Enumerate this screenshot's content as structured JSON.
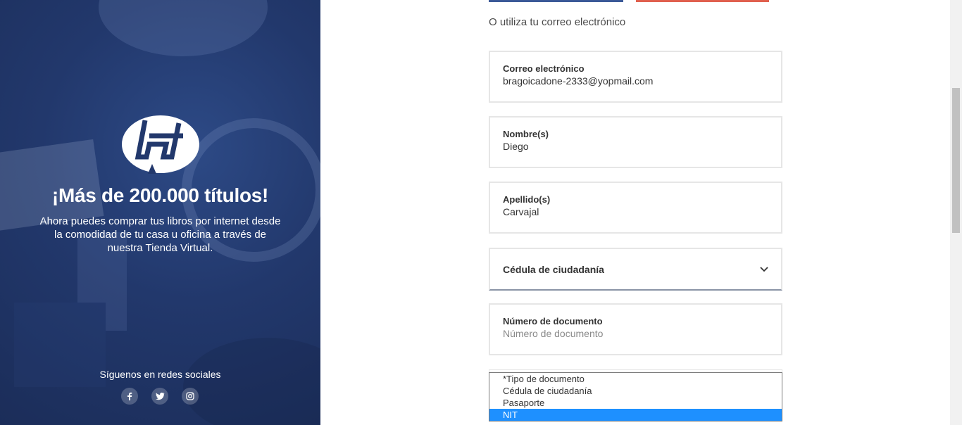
{
  "promo": {
    "headline": "¡Más de 200.000 títulos!",
    "description": "Ahora puedes comprar tus libros por internet desde la comodidad de tu casa u oficina a través de nuestra Tienda Virtual.",
    "follow_text": "Síguenos en redes sociales",
    "social_icons": [
      "facebook-icon",
      "twitter-icon",
      "instagram-icon"
    ]
  },
  "form": {
    "alt_login_text": "O utiliza tu correo electrónico",
    "email": {
      "label": "Correo electrónico",
      "value": "bragoicadone-2333@yopmail.com"
    },
    "first_name": {
      "label": "Nombre(s)",
      "value": "Diego"
    },
    "last_name": {
      "label": "Apellido(s)",
      "value": "Carvajal"
    },
    "document_type": {
      "selected": "Cédula de ciudadanía"
    },
    "document_number": {
      "label": "Número de documento",
      "placeholder": "Número de documento",
      "value": ""
    },
    "dropdown_options": [
      "*Tipo de documento",
      "Cédula de ciudadanía",
      "Pasaporte",
      "NIT"
    ],
    "highlighted_option": "NIT"
  },
  "colors": {
    "panel": "#22386c",
    "facebook": "#3b5998",
    "google": "#e0604e",
    "highlight": "#1e90ff"
  }
}
